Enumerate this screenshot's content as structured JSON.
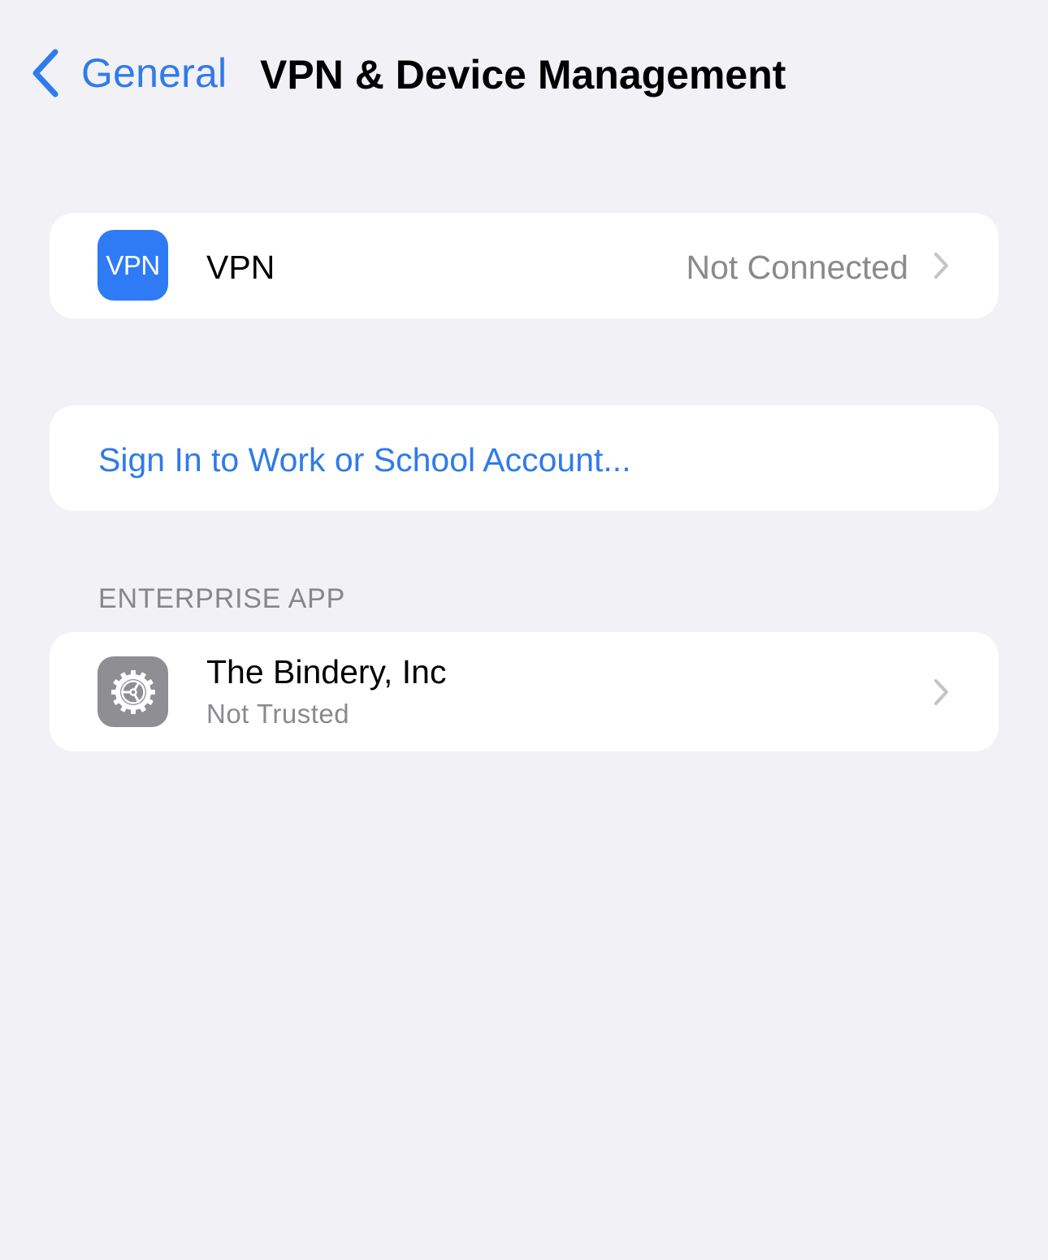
{
  "nav": {
    "back_label": "General",
    "title": "VPN & Device Management"
  },
  "vpn_row": {
    "icon_text": "VPN",
    "label": "VPN",
    "status": "Not Connected"
  },
  "signin": {
    "label": "Sign In to Work or School Account..."
  },
  "enterprise": {
    "section_header": "ENTERPRISE APP",
    "app_name": "The Bindery, Inc",
    "trust_status": "Not Trusted"
  },
  "colors": {
    "accent": "#2F7BEA",
    "background": "#F1F1F6",
    "card": "#FFFFFF",
    "secondary_text": "#8A8A8E",
    "settings_icon": "#8E8E93"
  },
  "icons": {
    "back": "chevron-left-icon",
    "row_disclosure": "chevron-right-icon",
    "enterprise_app": "gear-icon"
  }
}
